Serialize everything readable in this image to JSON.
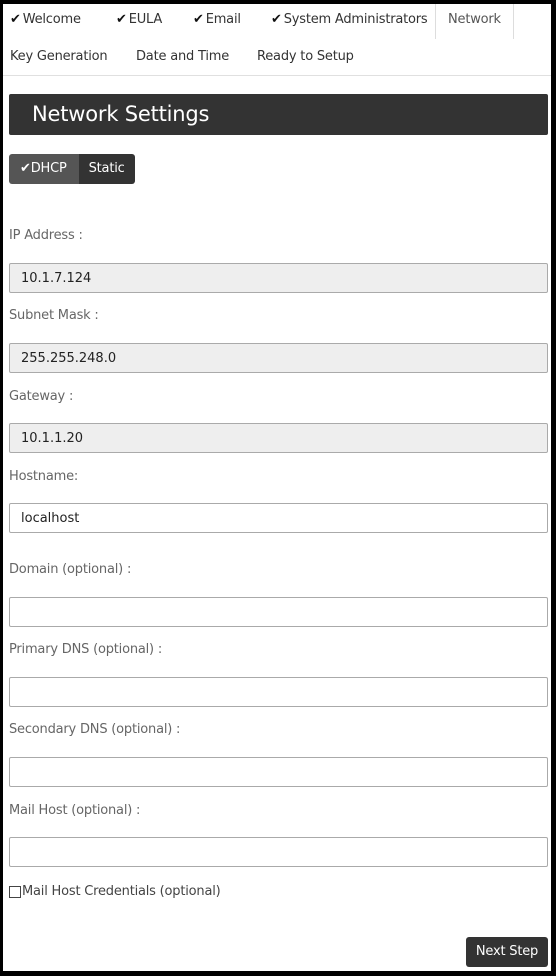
{
  "tabs": [
    {
      "label": "Welcome",
      "completed": true,
      "active": false
    },
    {
      "label": "EULA",
      "completed": true,
      "active": false
    },
    {
      "label": "Email",
      "completed": true,
      "active": false
    },
    {
      "label": "System Administrators",
      "completed": true,
      "active": false
    },
    {
      "label": "Network",
      "completed": false,
      "active": true
    },
    {
      "label": "Key Generation",
      "completed": false,
      "active": false
    },
    {
      "label": "Date and Time",
      "completed": false,
      "active": false
    },
    {
      "label": "Ready to Setup",
      "completed": false,
      "active": false
    }
  ],
  "check_glyph": "✔",
  "header": {
    "title": "Network Settings"
  },
  "mode_toggle": {
    "options": [
      {
        "label": "DHCP",
        "selected": true
      },
      {
        "label": "Static",
        "selected": false
      }
    ]
  },
  "fields": {
    "ip_address": {
      "label": "IP Address :",
      "value": "10.1.7.124",
      "readonly": true
    },
    "subnet_mask": {
      "label": "Subnet Mask :",
      "value": "255.255.248.0",
      "readonly": true
    },
    "gateway": {
      "label": "Gateway :",
      "value": "10.1.1.20",
      "readonly": true
    },
    "hostname": {
      "label": "Hostname:",
      "value": "localhost",
      "readonly": false
    },
    "domain": {
      "label": "Domain (optional) :",
      "value": "",
      "readonly": false
    },
    "primary_dns": {
      "label": "Primary DNS (optional) :",
      "value": "",
      "readonly": false
    },
    "secondary_dns": {
      "label": "Secondary DNS (optional) :",
      "value": "",
      "readonly": false
    },
    "mail_host": {
      "label": "Mail Host (optional) :",
      "value": "",
      "readonly": false
    }
  },
  "mail_host_credentials": {
    "label": "Mail Host Credentials (optional)",
    "checked": false
  },
  "next_button": {
    "label": "Next Step"
  }
}
